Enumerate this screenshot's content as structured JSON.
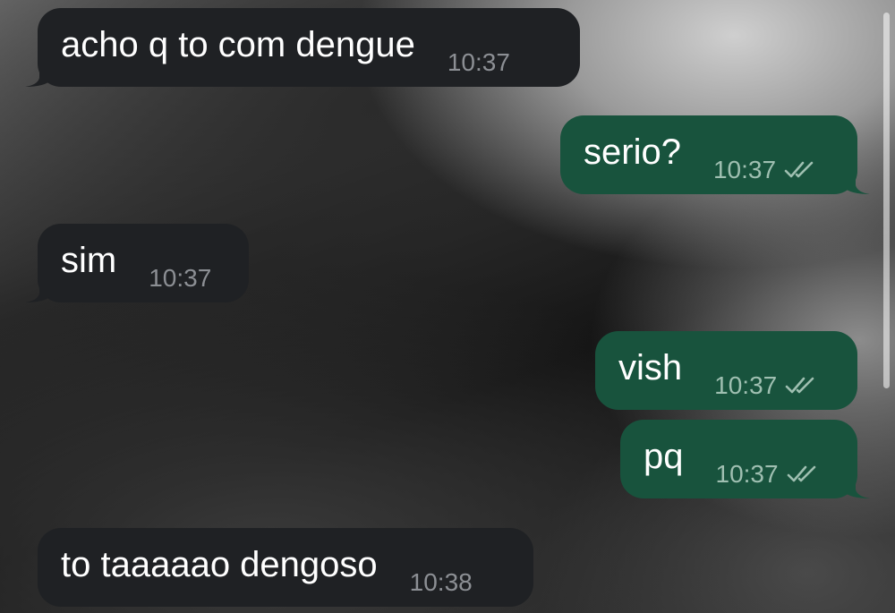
{
  "colors": {
    "incoming_bubble": "#1f2124",
    "outgoing_bubble": "#18533d",
    "incoming_time": "#8c8f94",
    "outgoing_time": "#9fbfb1",
    "message_text": "#ffffff"
  },
  "messages": [
    {
      "direction": "incoming",
      "text": "acho q to com dengue",
      "time": "10:37",
      "tail": true
    },
    {
      "direction": "outgoing",
      "text": "serio?",
      "time": "10:37",
      "status": "read",
      "status_icon": "double-check-icon",
      "tail": true
    },
    {
      "direction": "incoming",
      "text": "sim",
      "time": "10:37",
      "tail": true
    },
    {
      "direction": "outgoing",
      "text": "vish",
      "time": "10:37",
      "status": "read",
      "status_icon": "double-check-icon",
      "tail": false
    },
    {
      "direction": "outgoing",
      "text": "pq",
      "time": "10:37",
      "status": "read",
      "status_icon": "double-check-icon",
      "tail": true
    },
    {
      "direction": "incoming",
      "text": "to taaaaao dengoso",
      "time": "10:38",
      "tail": false
    }
  ]
}
